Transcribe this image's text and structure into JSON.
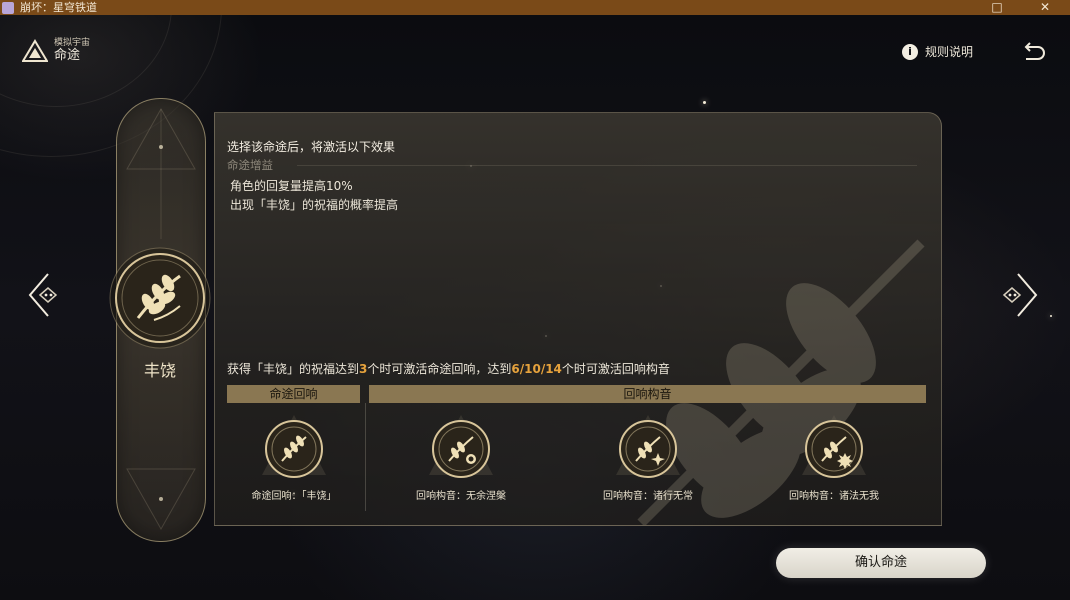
{
  "window": {
    "title": "崩坏：星穹铁道"
  },
  "header": {
    "subtitle": "模拟宇宙",
    "title": "命途",
    "rules_label": "规则说明",
    "info_glyph": "i"
  },
  "path": {
    "name": "丰饶"
  },
  "panel": {
    "heading": "选择该命途后，将激活以下效果",
    "sub_heading": "命途增益",
    "effects": [
      "角色的回复量提高10%",
      "出现「丰饶」的祝福的概率提高"
    ],
    "requirement": {
      "part1": "获得「丰饶」的祝福达到",
      "count_a": "3",
      "part2": "个时可激活命途回响，达到",
      "count_b": "6/10/14",
      "part3": "个时可激活回响构音"
    },
    "left_header": "命途回响",
    "right_header": "回响构音",
    "resonance": {
      "label": "命途回响：「丰饶」"
    },
    "formations": [
      {
        "label": "回响构音：无余涅槃"
      },
      {
        "label": "回响构音：诸行无常"
      },
      {
        "label": "回响构音：诸法无我"
      }
    ]
  },
  "confirm_button": {
    "label": "确认命途"
  },
  "colors": {
    "accent": "#e6a23c",
    "gold": "#8a7752",
    "titlebar": "#7a4a18"
  }
}
